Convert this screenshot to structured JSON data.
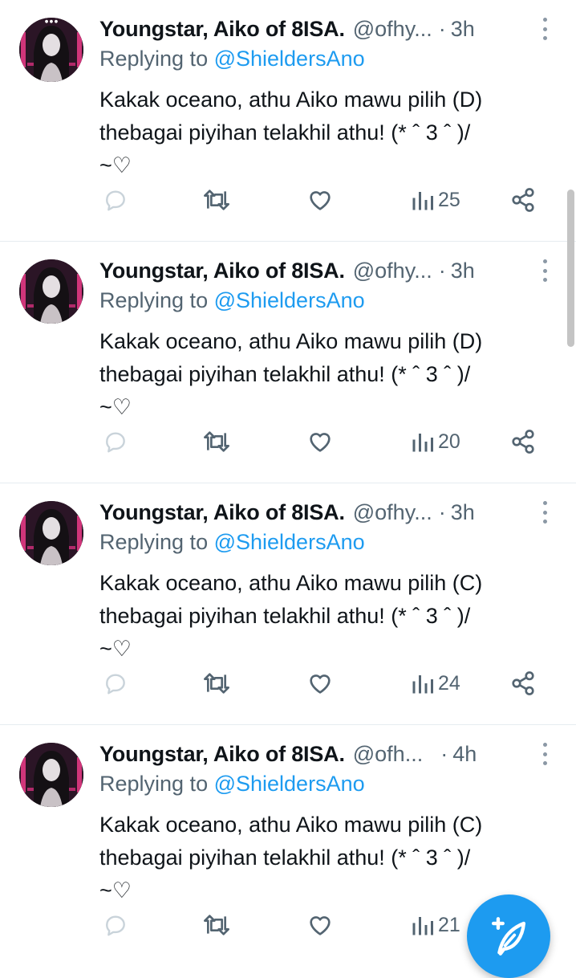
{
  "tweets": [
    {
      "author_name": "Youngstar, Aiko of 8ISA.",
      "handle": "@ofhy...",
      "separator": "·",
      "time": "3h",
      "replying_prefix": "Replying to ",
      "replying_to": "@ShieldersAno",
      "text_line1": "Kakak oceano, athu Aiko mawu pilih (D)",
      "text_line2": "thebagai piyihan telakhil athu! (* ˆ 3 ˆ )/",
      "text_line3": "~♡",
      "views": "25"
    },
    {
      "author_name": "Youngstar, Aiko of 8ISA.",
      "handle": "@ofhy...",
      "separator": "·",
      "time": "3h",
      "replying_prefix": "Replying to ",
      "replying_to": "@ShieldersAno",
      "text_line1": "Kakak oceano, athu Aiko mawu pilih (D)",
      "text_line2": "thebagai piyihan telakhil athu! (* ˆ 3 ˆ )/",
      "text_line3": "~♡",
      "views": "20"
    },
    {
      "author_name": "Youngstar, Aiko of 8ISA.",
      "handle": "@ofhy...",
      "separator": "·",
      "time": "3h",
      "replying_prefix": "Replying to ",
      "replying_to": "@ShieldersAno",
      "text_line1": "Kakak oceano, athu Aiko mawu pilih (C)",
      "text_line2": "thebagai piyihan telakhil athu! (* ˆ 3 ˆ )/",
      "text_line3": "~♡",
      "views": "24"
    },
    {
      "author_name": "Youngstar, Aiko of 8ISA.",
      "handle": "@ofh...",
      "separator": "·",
      "time": "4h",
      "replying_prefix": "Replying to ",
      "replying_to": "@ShieldersAno",
      "text_line1": "Kakak oceano, athu Aiko mawu pilih (C)",
      "text_line2": "thebagai piyihan telakhil athu! (* ˆ 3 ˆ )/",
      "text_line3": "~♡",
      "views": "21"
    }
  ],
  "icons": {
    "reply": "reply-icon",
    "retweet": "retweet-icon",
    "like": "heart-icon",
    "views": "views-chart-icon",
    "share": "share-icon",
    "more": "more-vertical-icon",
    "compose": "compose-icon"
  },
  "colors": {
    "accent": "#1d9bf0",
    "secondary_text": "#536471",
    "primary_text": "#0f1419"
  }
}
